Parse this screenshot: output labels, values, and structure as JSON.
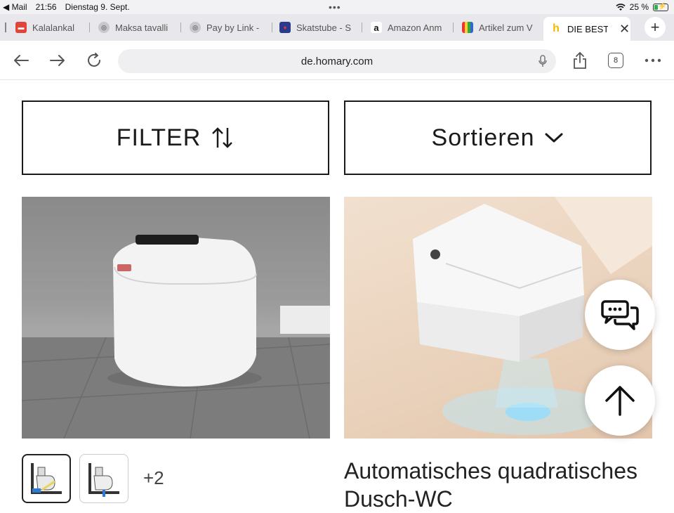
{
  "status_bar": {
    "back_app": "Mail",
    "time": "21:56",
    "date": "Dienstag 9. Sept.",
    "battery": "25 %",
    "battery_level": 0.25
  },
  "tabs": [
    {
      "label": "Kalalankal",
      "favicon": "bookmark-red-icon",
      "color": "#e0443a"
    },
    {
      "label": "Maksa tavalli",
      "favicon": "globe-icon",
      "color": "#9a9a9a"
    },
    {
      "label": "Pay by Link -",
      "favicon": "globe-icon",
      "color": "#9a9a9a"
    },
    {
      "label": "Skatstube - S",
      "favicon": "skatstube-icon",
      "color": "#2a3a8c"
    },
    {
      "label": "Amazon Anm",
      "favicon": "amazon-icon",
      "color": "#111111"
    },
    {
      "label": "Artikel zum V",
      "favicon": "tv-icon",
      "color": "#7a4b2a"
    },
    {
      "label": "DIE BEST",
      "favicon": "homary-icon",
      "color": "#f5b800",
      "active": true
    }
  ],
  "address_bar": {
    "url": "de.homary.com",
    "tab_count": "8"
  },
  "controls": {
    "filter_label": "FILTER",
    "sort_label": "Sortieren"
  },
  "products": [
    {
      "image": "smart-toilet-round-white",
      "thumbnail_more": "+2"
    },
    {
      "image": "smart-toilet-square-wall-hung",
      "title": "Automatisches quadratisches Dusch-WC"
    }
  ],
  "colors": {
    "accent": "#1a1a1a",
    "page_bg": "#ffffff",
    "tab_bar_bg": "#e8e8ec",
    "url_field_bg": "#efeff2"
  }
}
